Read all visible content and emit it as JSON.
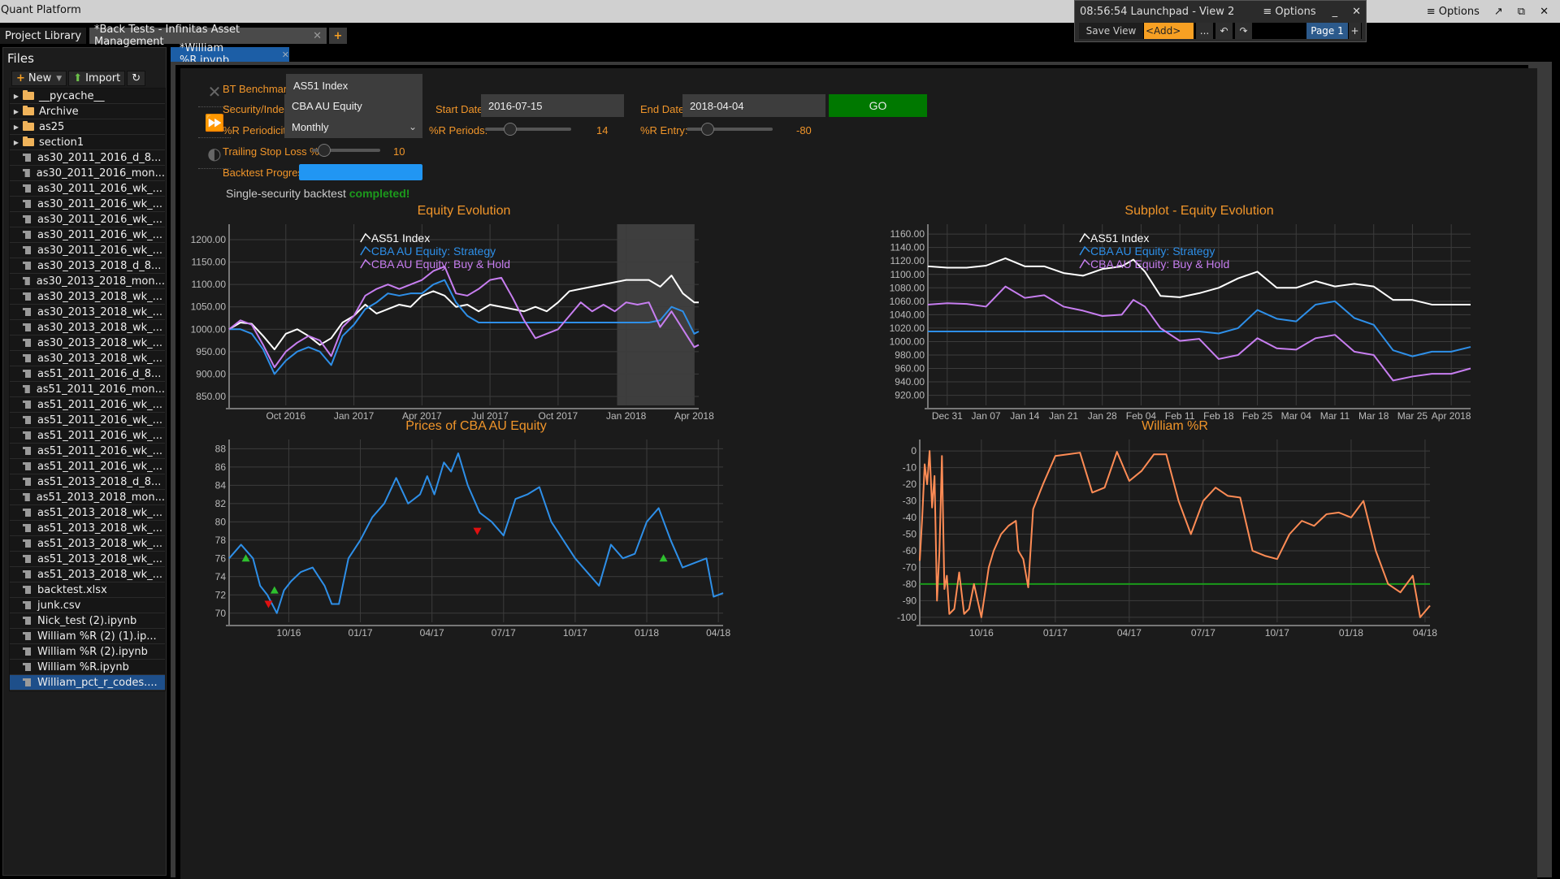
{
  "window": {
    "app_title": "Quant Platform",
    "options_label": "≡ Options",
    "popout_icon": "↗",
    "restore_icon": "⧉",
    "close_icon": "✕"
  },
  "launchpad": {
    "title": "08:56:54 Launchpad - View 2",
    "options_label": "≡ Options",
    "minimize_icon": "_",
    "close_icon": "✕",
    "save_view": "Save View",
    "add": "<Add>",
    "more": "...",
    "undo_icon": "↶",
    "redo_icon": "↷",
    "page": "Page 1",
    "add_page": "+"
  },
  "tabs": {
    "project_library": "Project Library",
    "back_tests": "*Back Tests - Infinitas Asset Management",
    "close_icon": "✕",
    "add_tab": "+"
  },
  "files": {
    "title": "Files",
    "new_label": "New",
    "import_label": "Import",
    "refresh_icon": "↻",
    "items": [
      {
        "name": "__pycache__",
        "type": "folder"
      },
      {
        "name": "Archive",
        "type": "folder"
      },
      {
        "name": "as25",
        "type": "folder"
      },
      {
        "name": "section1",
        "type": "folder"
      },
      {
        "name": "as30_2011_2016_d_8...",
        "type": "file"
      },
      {
        "name": "as30_2011_2016_mon...",
        "type": "file"
      },
      {
        "name": "as30_2011_2016_wk_...",
        "type": "file"
      },
      {
        "name": "as30_2011_2016_wk_...",
        "type": "file"
      },
      {
        "name": "as30_2011_2016_wk_...",
        "type": "file"
      },
      {
        "name": "as30_2011_2016_wk_...",
        "type": "file"
      },
      {
        "name": "as30_2011_2016_wk_...",
        "type": "file"
      },
      {
        "name": "as30_2013_2018_d_8...",
        "type": "file"
      },
      {
        "name": "as30_2013_2018_mon...",
        "type": "file"
      },
      {
        "name": "as30_2013_2018_wk_...",
        "type": "file"
      },
      {
        "name": "as30_2013_2018_wk_...",
        "type": "file"
      },
      {
        "name": "as30_2013_2018_wk_...",
        "type": "file"
      },
      {
        "name": "as30_2013_2018_wk_...",
        "type": "file"
      },
      {
        "name": "as30_2013_2018_wk_...",
        "type": "file"
      },
      {
        "name": "as51_2011_2016_d_8...",
        "type": "file"
      },
      {
        "name": "as51_2011_2016_mon...",
        "type": "file"
      },
      {
        "name": "as51_2011_2016_wk_...",
        "type": "file"
      },
      {
        "name": "as51_2011_2016_wk_...",
        "type": "file"
      },
      {
        "name": "as51_2011_2016_wk_...",
        "type": "file"
      },
      {
        "name": "as51_2011_2016_wk_...",
        "type": "file"
      },
      {
        "name": "as51_2011_2016_wk_...",
        "type": "file"
      },
      {
        "name": "as51_2013_2018_d_8...",
        "type": "file"
      },
      {
        "name": "as51_2013_2018_mon...",
        "type": "file"
      },
      {
        "name": "as51_2013_2018_wk_...",
        "type": "file"
      },
      {
        "name": "as51_2013_2018_wk_...",
        "type": "file"
      },
      {
        "name": "as51_2013_2018_wk_...",
        "type": "file"
      },
      {
        "name": "as51_2013_2018_wk_...",
        "type": "file"
      },
      {
        "name": "as51_2013_2018_wk_...",
        "type": "file"
      },
      {
        "name": "backtest.xlsx",
        "type": "file"
      },
      {
        "name": "junk.csv",
        "type": "file"
      },
      {
        "name": "Nick_test (2).ipynb",
        "type": "file"
      },
      {
        "name": "William %R (2) (1).ip...",
        "type": "file"
      },
      {
        "name": "William %R (2).ipynb",
        "type": "file"
      },
      {
        "name": "William %R.ipynb",
        "type": "file"
      },
      {
        "name": "William_pct_r_codes....",
        "type": "file",
        "selected": true
      }
    ]
  },
  "notebook": {
    "tab_label": "*William %R.ipynb",
    "close_icon": "✕",
    "side_icons": [
      "collapse-icon",
      "run-all-icon",
      "kernel-icon"
    ]
  },
  "form": {
    "benchmark_label": "BT Benchmark:",
    "benchmark_value": "AS51 Index",
    "security_label": "Security/Index:",
    "security_value": "CBA AU Equity",
    "start_label": "Start Date:",
    "start_value": "2016-07-15",
    "end_label": "End Date:",
    "end_value": "2018-04-04",
    "go_label": "GO",
    "periodicity_label": "%R Periodicity:",
    "periodicity_value": "Monthly",
    "periods_label": "%R Periods:",
    "periods_value": "14",
    "periods_slider_fraction": 0.25,
    "entry_label": "%R Entry:",
    "entry_value": "-80",
    "entry_slider_fraction": 0.2,
    "stoploss_label": "Trailing Stop Loss %:",
    "stoploss_value": "10",
    "stoploss_slider_fraction": 0.1,
    "progress_label": "Backtest Progress:",
    "progress_fraction": 1.0,
    "status_prefix": "Single-security backtest ",
    "status_done": "completed!"
  },
  "colors": {
    "accent_orange": "#f0952a",
    "index_white": "#ffffff",
    "strategy_blue": "#2e8fe8",
    "buyhold_purple": "#c77ef0",
    "price_blue": "#2e8fe8",
    "wr_orange": "#ff8c55",
    "entry_green": "#1a9a1a",
    "buy_marker": "#2ec02e",
    "sell_marker": "#e01010"
  },
  "chart_data": [
    {
      "id": "equity",
      "type": "line",
      "title": "Equity Evolution",
      "xlabel": "",
      "ylabel": "",
      "x_ticks": [
        "Oct 2016",
        "Jan 2017",
        "Apr 2017",
        "Jul 2017",
        "Oct 2017",
        "Jan 2018",
        "Apr 2018"
      ],
      "x_tick_pos": [
        2.5,
        5.5,
        8.5,
        11.5,
        14.5,
        17.5,
        20.5
      ],
      "xlim": [
        0,
        20.7
      ],
      "y_ticks": [
        "850.00",
        "900.00",
        "950.00",
        "1000.00",
        "1050.00",
        "1100.00",
        "1150.00",
        "1200.00"
      ],
      "ylim": [
        830,
        1220
      ],
      "grid": true,
      "highlight_range": [
        17.1,
        20.5
      ],
      "legend": [
        "AS51 Index",
        "CBA AU Equity: Strategy",
        "CBA AU Equity: Buy & Hold"
      ],
      "legend_position": "top-center",
      "x": [
        0,
        0.5,
        1,
        1.5,
        2,
        2.5,
        3,
        3.5,
        4,
        4.5,
        5,
        5.5,
        6,
        6.5,
        7,
        7.5,
        8,
        8.5,
        9,
        9.5,
        10,
        10.5,
        11,
        11.5,
        12,
        12.5,
        13,
        13.5,
        14,
        14.5,
        15,
        15.5,
        16,
        16.5,
        17,
        17.5,
        18,
        18.5,
        19,
        19.5,
        20,
        20.5,
        20.7
      ],
      "series": [
        {
          "name": "AS51 Index",
          "color": "#ffffff",
          "values": [
            1000,
            1015,
            1012,
            985,
            955,
            990,
            1000,
            985,
            965,
            980,
            1015,
            1030,
            1055,
            1035,
            1045,
            1055,
            1050,
            1075,
            1085,
            1075,
            1050,
            1055,
            1040,
            1055,
            1050,
            1045,
            1040,
            1050,
            1040,
            1060,
            1085,
            1090,
            1095,
            1100,
            1105,
            1110,
            1110,
            1110,
            1095,
            1120,
            1080,
            1060,
            1060
          ]
        },
        {
          "name": "CBA AU Equity: Strategy",
          "color": "#2e8fe8",
          "values": [
            1000,
            1000,
            990,
            955,
            900,
            930,
            950,
            960,
            950,
            920,
            985,
            1010,
            1045,
            1060,
            1080,
            1075,
            1080,
            1080,
            1100,
            1110,
            1060,
            1030,
            1015,
            1015,
            1015,
            1015,
            1015,
            1015,
            1015,
            1015,
            1015,
            1015,
            1015,
            1015,
            1015,
            1015,
            1015,
            1015,
            1020,
            1050,
            1040,
            990,
            995
          ]
        },
        {
          "name": "CBA AU Equity: Buy & Hold",
          "color": "#c77ef0",
          "values": [
            1000,
            1020,
            1010,
            965,
            915,
            950,
            970,
            985,
            975,
            940,
            1005,
            1030,
            1075,
            1090,
            1100,
            1090,
            1100,
            1110,
            1130,
            1140,
            1080,
            1075,
            1090,
            1110,
            1115,
            1070,
            1020,
            980,
            990,
            1000,
            1030,
            1060,
            1040,
            1055,
            1040,
            1060,
            1055,
            1060,
            1005,
            1040,
            1000,
            960,
            965
          ]
        }
      ]
    },
    {
      "id": "subplot",
      "type": "line",
      "title": "Subplot - Equity Evolution",
      "xlabel": "",
      "ylabel": "",
      "x_ticks": [
        "Dec 31",
        "Jan 07",
        "Jan 14",
        "Jan 21",
        "Jan 28",
        "Feb 04",
        "Feb 11",
        "Feb 18",
        "Feb 25",
        "Mar 04",
        "Mar 11",
        "Mar 18",
        "Mar 25",
        "Apr 2018"
      ],
      "x_tick_pos": [
        0.5,
        1.5,
        2.5,
        3.5,
        4.5,
        5.5,
        6.5,
        7.5,
        8.5,
        9.5,
        10.5,
        11.5,
        12.5,
        13.5
      ],
      "xlim": [
        0,
        14
      ],
      "y_ticks": [
        "920.00",
        "940.00",
        "960.00",
        "980.00",
        "1000.00",
        "1020.00",
        "1040.00",
        "1060.00",
        "1080.00",
        "1100.00",
        "1120.00",
        "1140.00",
        "1160.00"
      ],
      "ylim": [
        905,
        1165
      ],
      "grid": true,
      "legend": [
        "AS51 Index",
        "CBA AU Equity: Strategy",
        "CBA AU Equity: Buy & Hold"
      ],
      "legend_position": "top-center",
      "x": [
        0,
        0.5,
        1,
        1.5,
        2,
        2.5,
        3,
        3.5,
        4,
        4.5,
        5,
        5.3,
        5.6,
        6,
        6.5,
        7,
        7.5,
        8,
        8.5,
        9,
        9.5,
        10,
        10.5,
        11,
        11.5,
        12,
        12.5,
        13,
        13.5,
        14
      ],
      "series": [
        {
          "name": "AS51 Index",
          "color": "#ffffff",
          "values": [
            1112,
            1110,
            1110,
            1113,
            1124,
            1112,
            1112,
            1102,
            1098,
            1108,
            1112,
            1122,
            1104,
            1068,
            1066,
            1072,
            1080,
            1094,
            1104,
            1080,
            1080,
            1090,
            1082,
            1086,
            1082,
            1062,
            1062,
            1055,
            1055,
            1055
          ]
        },
        {
          "name": "CBA AU Equity: Strategy",
          "color": "#2e8fe8",
          "values": [
            1015,
            1015,
            1015,
            1015,
            1015,
            1015,
            1015,
            1015,
            1015,
            1015,
            1015,
            1015,
            1015,
            1015,
            1015,
            1015,
            1012,
            1020,
            1047,
            1034,
            1030,
            1055,
            1060,
            1035,
            1025,
            987,
            978,
            985,
            985,
            992
          ]
        },
        {
          "name": "CBA AU Equity: Buy & Hold",
          "color": "#c77ef0",
          "values": [
            1055,
            1057,
            1056,
            1052,
            1082,
            1065,
            1069,
            1052,
            1046,
            1038,
            1040,
            1062,
            1052,
            1020,
            1001,
            1004,
            974,
            980,
            1005,
            990,
            988,
            1005,
            1010,
            985,
            980,
            942,
            948,
            952,
            952,
            960
          ]
        }
      ]
    },
    {
      "id": "prices",
      "type": "line",
      "title": "Prices of CBA AU Equity",
      "xlabel": "",
      "ylabel": "",
      "x_ticks": [
        "10/16",
        "01/17",
        "04/17",
        "07/17",
        "10/17",
        "01/18",
        "04/18"
      ],
      "x_tick_pos": [
        2.5,
        5.5,
        8.5,
        11.5,
        14.5,
        17.5,
        20.5
      ],
      "xlim": [
        0,
        20.7
      ],
      "y_ticks": [
        "70",
        "72",
        "74",
        "76",
        "78",
        "80",
        "82",
        "84",
        "86",
        "88"
      ],
      "ylim": [
        69,
        88.3
      ],
      "grid": true,
      "x": [
        0,
        0.5,
        1,
        1.3,
        1.6,
        2,
        2.3,
        2.6,
        3,
        3.5,
        4,
        4.3,
        4.6,
        5,
        5.5,
        6,
        6.5,
        7,
        7.5,
        8,
        8.3,
        8.6,
        9,
        9.3,
        9.6,
        10,
        10.5,
        11,
        11.5,
        12,
        12.5,
        13,
        13.5,
        14,
        14.5,
        15,
        15.5,
        16,
        16.5,
        17,
        17.5,
        18,
        18.5,
        19,
        19.5,
        20,
        20.3,
        20.7
      ],
      "series": [
        {
          "name": "CBA AU Equity",
          "color": "#2e8fe8",
          "values": [
            76,
            77.5,
            76,
            73,
            72,
            70,
            72.5,
            73.5,
            74.5,
            75,
            73,
            71,
            71,
            76,
            78,
            80.5,
            82,
            84.8,
            82,
            83,
            85,
            83,
            86.5,
            85.5,
            87.5,
            84,
            81,
            80,
            78.5,
            82.5,
            83,
            83.8,
            80,
            78,
            76,
            74.5,
            73,
            77.5,
            76,
            76.5,
            80,
            81.5,
            78,
            75,
            75.5,
            76,
            71.8,
            72.2
          ]
        }
      ],
      "markers": [
        {
          "x": 0.7,
          "y": 76,
          "type": "buy"
        },
        {
          "x": 1.65,
          "y": 71,
          "type": "sell"
        },
        {
          "x": 1.9,
          "y": 72.5,
          "type": "buy"
        },
        {
          "x": 10.4,
          "y": 79,
          "type": "sell"
        },
        {
          "x": 18.2,
          "y": 76,
          "type": "buy"
        }
      ]
    },
    {
      "id": "williams",
      "type": "line",
      "title": "William %R",
      "xlabel": "",
      "ylabel": "",
      "x_ticks": [
        "10/16",
        "01/17",
        "04/17",
        "07/17",
        "10/17",
        "01/18",
        "04/18"
      ],
      "x_tick_pos": [
        2.5,
        5.5,
        8.5,
        11.5,
        14.5,
        17.5,
        20.5
      ],
      "xlim": [
        0,
        20.7
      ],
      "y_ticks": [
        "-100",
        "-90",
        "-80",
        "-70",
        "-60",
        "-50",
        "-40",
        "-30",
        "-20",
        "-10",
        "0"
      ],
      "ylim": [
        -103,
        3
      ],
      "grid": true,
      "hline": {
        "value": -80,
        "color": "#1a9a1a"
      },
      "x": [
        0,
        0.1,
        0.2,
        0.3,
        0.4,
        0.5,
        0.6,
        0.7,
        0.8,
        0.9,
        1,
        1.1,
        1.2,
        1.4,
        1.6,
        1.8,
        2,
        2.2,
        2.5,
        2.8,
        3,
        3.3,
        3.6,
        3.9,
        4,
        4.2,
        4.4,
        4.6,
        5,
        5.5,
        6,
        6.5,
        7,
        7.5,
        8,
        8.5,
        9,
        9.5,
        10,
        10.5,
        11,
        11.5,
        12,
        12.5,
        13,
        13.5,
        14,
        14.5,
        15,
        15.5,
        16,
        16.5,
        17,
        17.5,
        18,
        18.5,
        19,
        19.5,
        20,
        20.3,
        20.7
      ],
      "series": [
        {
          "name": "William %R",
          "color": "#ff8c55",
          "values": [
            -66,
            -40,
            -8,
            -20,
            0,
            -34,
            -15,
            -90,
            -60,
            -3,
            -83,
            -75,
            -98,
            -95,
            -73,
            -98,
            -95,
            -80,
            -100,
            -70,
            -60,
            -50,
            -45,
            -42,
            -60,
            -65,
            -82,
            -35,
            -20,
            -3,
            -2,
            -1,
            -25,
            -22,
            -0.5,
            -18,
            -12,
            -2,
            -2,
            -30,
            -50,
            -30,
            -22,
            -27,
            -28,
            -60,
            -63,
            -65,
            -50,
            -42,
            -45,
            -38,
            -37,
            -40,
            -30,
            -60,
            -80,
            -85,
            -75,
            -100,
            -93
          ]
        }
      ]
    }
  ]
}
